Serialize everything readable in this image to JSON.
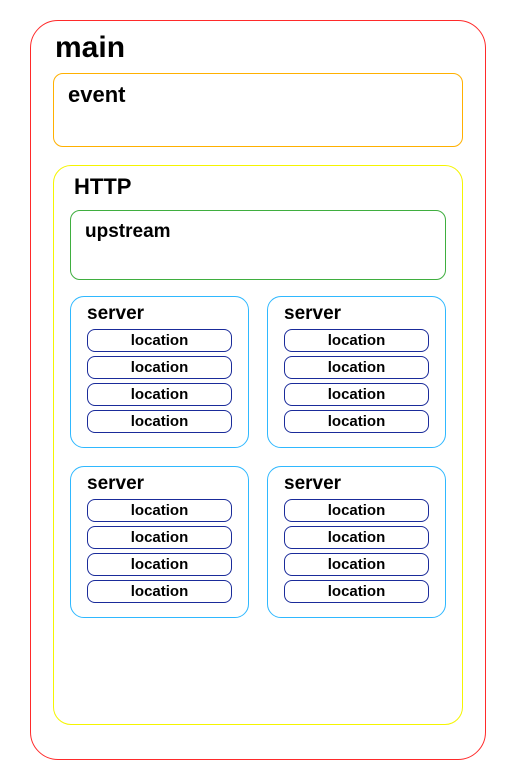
{
  "main": {
    "label": "main",
    "event": {
      "label": "event"
    },
    "http": {
      "label": "HTTP",
      "upstream": {
        "label": "upstream"
      },
      "servers": [
        {
          "label": "server",
          "locations": [
            "location",
            "location",
            "location",
            "location"
          ]
        },
        {
          "label": "server",
          "locations": [
            "location",
            "location",
            "location",
            "location"
          ]
        },
        {
          "label": "server",
          "locations": [
            "location",
            "location",
            "location",
            "location"
          ]
        },
        {
          "label": "server",
          "locations": [
            "location",
            "location",
            "location",
            "location"
          ]
        }
      ]
    }
  }
}
